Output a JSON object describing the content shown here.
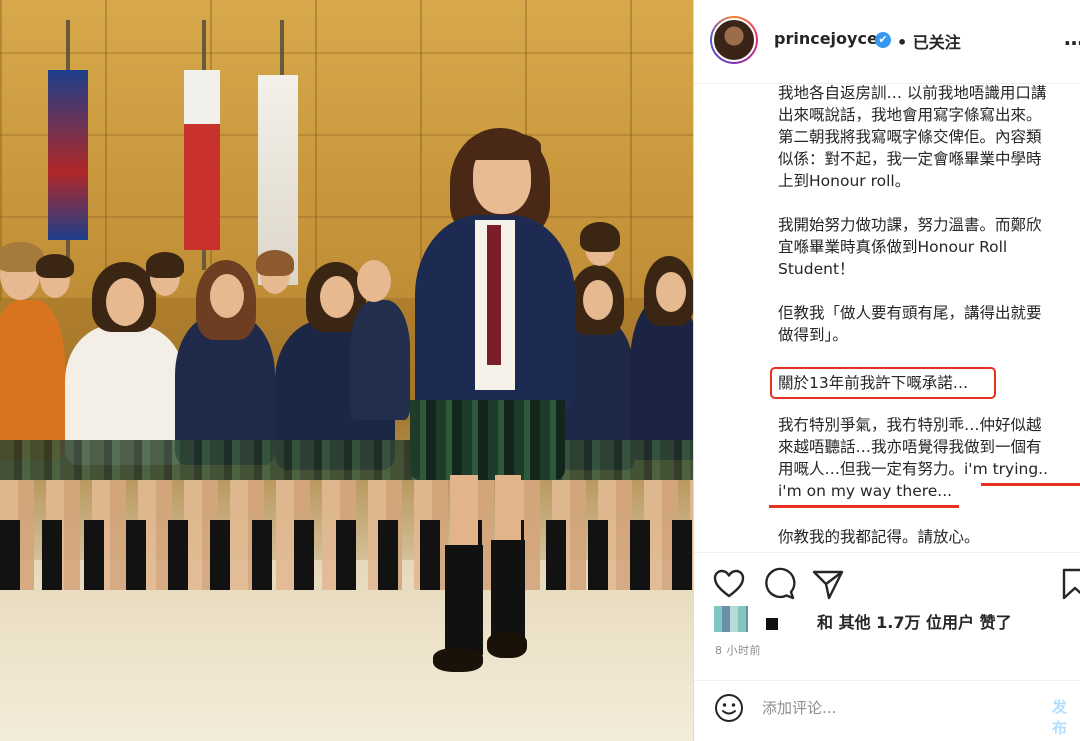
{
  "post": {
    "username": "princejoyce",
    "verified_badge": "✔",
    "follow_status": "• 已关注",
    "more_icon": "…"
  },
  "caption": {
    "p1": "我地各自返房訓… 以前我地唔識用口講\n出來嘅說話，我地會用寫字條寫出來。\n第二朝我將我寫嘅字條交俾佢。內容類\n似係：對不起，我一定會喺畢業中學時\n上到Honour roll。",
    "p2": "我開始努力做功課，努力溫書。而鄭欣\n宜喺畢業時真係做到Honour Roll\nStudent！",
    "p3": "佢教我「做人要有頭有尾，講得出就要\n做得到」。",
    "highlight": "關於13年前我許下嘅承諾…",
    "p4": "我冇特別爭氣，我冇特別乖…仲好似越\n來越唔聽話…我亦唔覺得我做到一個有\n用嘅人…但我一定有努力。i'm trying..\ni'm on my way there...",
    "p5": "你教我的我都記得。請放心。"
  },
  "icons": {
    "like": "heart-icon",
    "comment": "comment-icon",
    "share": "share-icon",
    "save": "bookmark-icon",
    "emoji": "smile-icon"
  },
  "likes": {
    "text": "和 其他 1.7万 位用户 赞了"
  },
  "timestamp": "8 小时前",
  "comment": {
    "placeholder": "添加评论...",
    "post_label": "发布"
  },
  "colors": {
    "highlight_red": "#e8321f",
    "verified_blue": "#3897f0"
  }
}
